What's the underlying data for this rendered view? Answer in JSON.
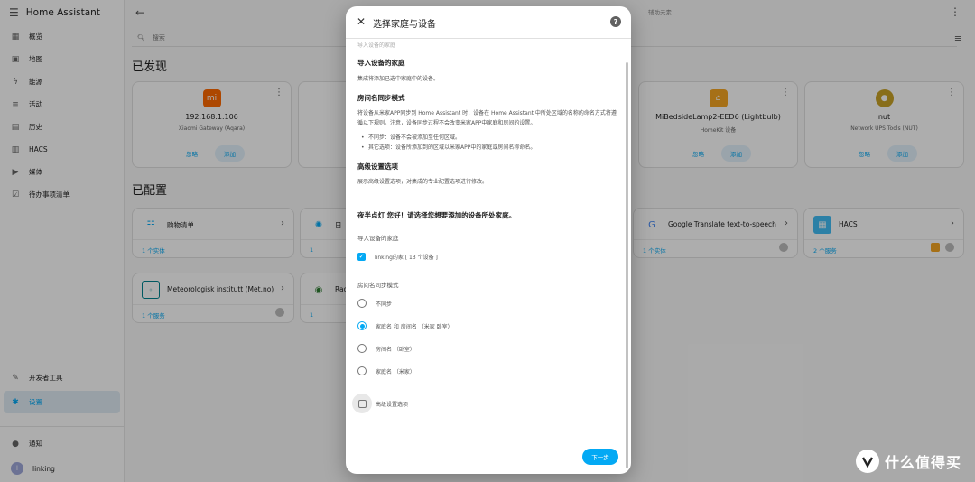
{
  "app": {
    "title": "Home Assistant"
  },
  "sidebar": {
    "items": [
      {
        "label": "概览",
        "icon": "overview-icon"
      },
      {
        "label": "地图",
        "icon": "map-icon"
      },
      {
        "label": "能源",
        "icon": "energy-icon"
      },
      {
        "label": "活动",
        "icon": "logbook-icon"
      },
      {
        "label": "历史",
        "icon": "history-icon"
      },
      {
        "label": "HACS",
        "icon": "hacs-icon"
      },
      {
        "label": "媒体",
        "icon": "media-icon"
      },
      {
        "label": "待办事项清单",
        "icon": "todo-icon"
      }
    ],
    "bottom": [
      {
        "label": "开发者工具",
        "icon": "developer-tools-icon"
      },
      {
        "label": "设置",
        "icon": "settings-icon",
        "active": true
      }
    ],
    "notifications": "通知",
    "user": {
      "initial": "l",
      "name": "linking"
    }
  },
  "header": {
    "help_text": "辅助元素"
  },
  "search": {
    "placeholder": "搜索"
  },
  "sections": {
    "discovered": "已发现",
    "configured": "已配置"
  },
  "discovered": [
    {
      "name": "192.168.1.106",
      "sub": "Xiaomi Gateway (Aqara)",
      "ignore": "忽略",
      "add": "添加",
      "color": "#ff6900"
    },
    {
      "name": "MiBedsideLamp2-EED6 (Lightbulb)",
      "sub": "HomeKit 设备",
      "ignore": "忽略",
      "add": "添加",
      "color": "#f5a623"
    },
    {
      "name": "nut",
      "sub": "Network UPS Tools (NUT)",
      "ignore": "忽略",
      "add": "添加",
      "color": "#c9a227"
    }
  ],
  "configured": [
    {
      "title": "购物清单",
      "foot": "1 个实体"
    },
    {
      "title": "Google Translate text-to-speech",
      "foot": "1 个实体"
    },
    {
      "title": "HACS",
      "foot": "2 个服务"
    },
    {
      "title": "Meteorologisk institutt (Met.no)",
      "foot": "1 个服务"
    },
    {
      "title": "日",
      "foot": "1"
    },
    {
      "title": "Rad",
      "foot": "1"
    }
  ],
  "dialog": {
    "title": "选择家庭与设备",
    "top_cut": "导入设备的家庭",
    "s1_title": "导入设备的家庭",
    "s1_desc": "集成将添加已选中家庭中的设备。",
    "s2_title": "房间名同步模式",
    "s2_desc": "将设备从米家APP同步到 Home Assistant 时，设备在 Home Assistant 中所处区域的名称的命名方式将遵循以下规则。注意，设备同步过程不会改变米家APP中家庭和房间的设置。",
    "s2_li1": "不同步：设备不会被添加至任何区域。",
    "s2_li2": "其它选项：设备所添加到的区域以米家APP中的家庭或房间名称命名。",
    "s3_title": "高级设置选项",
    "s3_desc": "展示高级设置选项，对集成的专业配置选项进行修改。",
    "prompt": "夜半点灯 您好！请选择您想要添加的设备所处家庭。",
    "home_label": "导入设备的家庭",
    "home_option": "linking的家 [ 13 个设备 ]",
    "sync_label": "房间名同步模式",
    "sync_options": [
      "不同步",
      "家庭名 和 房间名 （米家 卧室）",
      "房间名 （卧室）",
      "家庭名 （米家）"
    ],
    "advanced": "高级设置选项",
    "next": "下一步"
  },
  "watermark": {
    "text": "什么值得买"
  }
}
